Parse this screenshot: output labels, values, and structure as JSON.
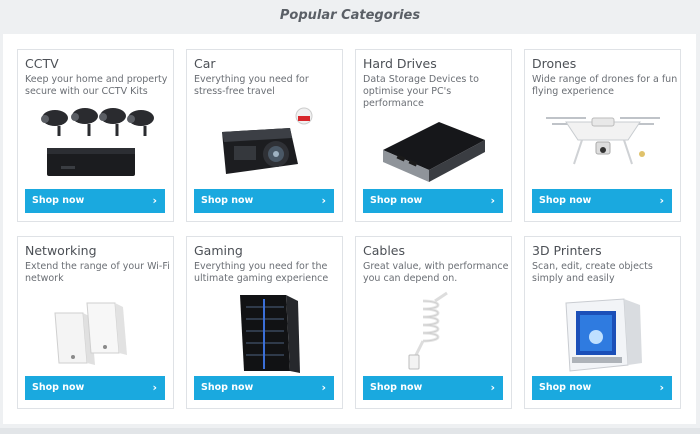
{
  "section": {
    "title": "Popular Categories"
  },
  "button_label": "Shop now",
  "chevron": "›",
  "accent": "#1aa9df",
  "categories": [
    {
      "title": "CCTV",
      "desc": "Keep your home and property secure with our CCTV Kits",
      "icon": "cctv-kit-icon"
    },
    {
      "title": "Car",
      "desc": "Everything you need for stress-free travel",
      "icon": "dash-cam-icon"
    },
    {
      "title": "Hard Drives",
      "desc": "Data Storage Devices to optimise your PC's performance",
      "icon": "hard-drive-icon"
    },
    {
      "title": "Drones",
      "desc": "Wide range of drones for a fun flying experience",
      "icon": "drone-icon"
    },
    {
      "title": "Networking",
      "desc": "Extend the range of your Wi-Fi network",
      "icon": "powerline-adapter-icon"
    },
    {
      "title": "Gaming",
      "desc": "Everything you need for the ultimate gaming experience",
      "icon": "gaming-pc-icon"
    },
    {
      "title": "Cables",
      "desc": "Great value, with performance you can depend on.",
      "icon": "cable-icon"
    },
    {
      "title": "3D Printers",
      "desc": "Scan, edit, create objects simply and easily",
      "icon": "3d-printer-icon"
    }
  ]
}
